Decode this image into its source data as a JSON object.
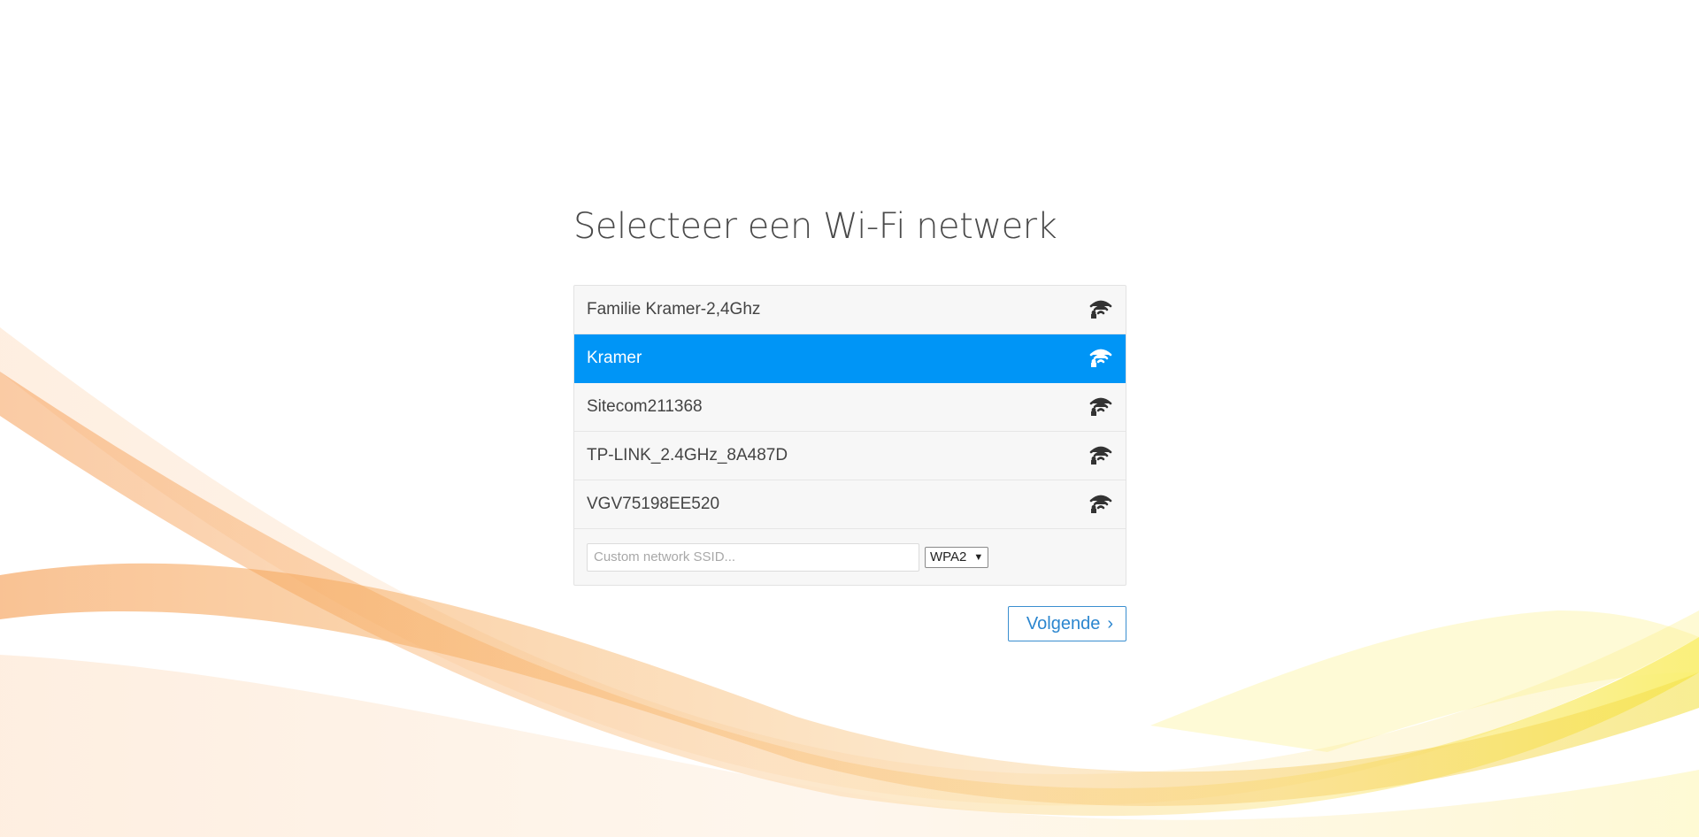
{
  "page": {
    "title": "Selecteer een Wi-Fi netwerk"
  },
  "networks": [
    {
      "ssid": "Familie Kramer-2,4Ghz",
      "icon": "wifi-lock-icon",
      "selected": false
    },
    {
      "ssid": "Kramer",
      "icon": "wifi-lock-icon",
      "selected": true
    },
    {
      "ssid": "Sitecom211368",
      "icon": "wifi-lock-icon",
      "selected": false
    },
    {
      "ssid": "TP-LINK_2.4GHz_8A487D",
      "icon": "wifi-lock-icon",
      "selected": false
    },
    {
      "ssid": "VGV75198EE520",
      "icon": "wifi-lock-icon",
      "selected": false
    }
  ],
  "custom": {
    "placeholder": "Custom network SSID...",
    "value": "",
    "security_selected": "WPA2"
  },
  "actions": {
    "next_label": "Volgende",
    "next_icon": "chevron-right-icon"
  },
  "colors": {
    "selected_bg": "#0095f6",
    "button_accent": "#2b86cf"
  }
}
